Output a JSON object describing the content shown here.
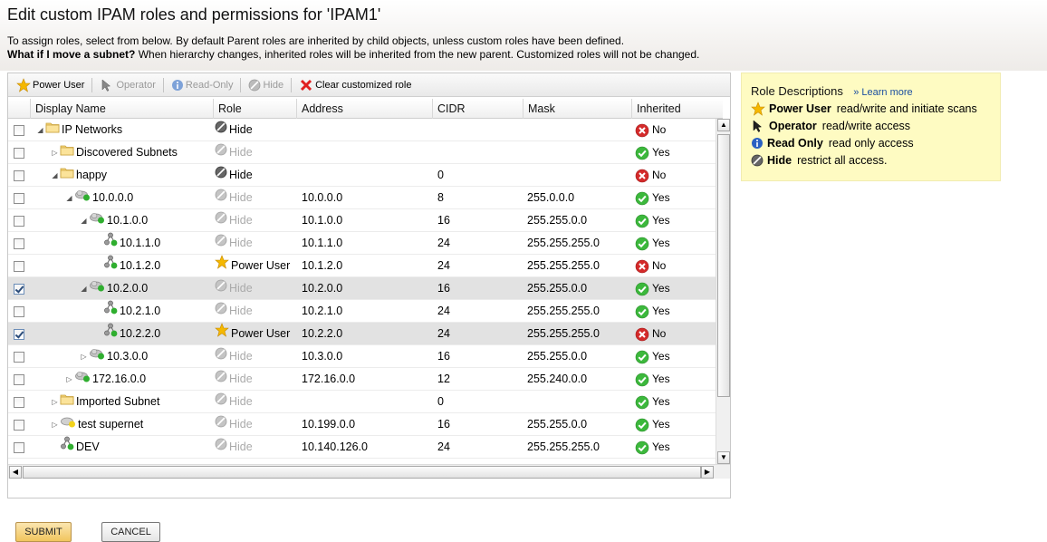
{
  "page": {
    "title": "Edit custom IPAM roles and permissions for 'IPAM1'",
    "intro_line1": "To assign roles, select from below. By default Parent roles are inherited by child objects, unless custom roles have been defined.",
    "intro_q": "What if I move a subnet?",
    "intro_line2": " When hierarchy changes, inherited roles will be inherited from the new parent. Customized roles will not be changed."
  },
  "toolbar": {
    "power_user": "Power User",
    "operator": "Operator",
    "read_only": "Read-Only",
    "hide": "Hide",
    "clear": "Clear customized role"
  },
  "columns": {
    "display_name": "Display Name",
    "role": "Role",
    "address": "Address",
    "cidr": "CIDR",
    "mask": "Mask",
    "inherited": "Inherited"
  },
  "rows": [
    {
      "indent": 0,
      "toggle": "open",
      "icon": "folder",
      "name": "IP Networks",
      "role": "Hide",
      "role_type": "hide-active",
      "address": "",
      "cidr": "",
      "mask": "",
      "inherited": "No",
      "checked": false,
      "selected": false
    },
    {
      "indent": 1,
      "toggle": "closed",
      "icon": "folder",
      "name": "Discovered Subnets",
      "role": "Hide",
      "role_type": "hide",
      "address": "",
      "cidr": "",
      "mask": "",
      "inherited": "Yes",
      "checked": false,
      "selected": false
    },
    {
      "indent": 1,
      "toggle": "open",
      "icon": "folder",
      "name": "happy",
      "role": "Hide",
      "role_type": "hide-active",
      "address": "",
      "cidr": "0",
      "mask": "",
      "inherited": "No",
      "checked": false,
      "selected": false
    },
    {
      "indent": 2,
      "toggle": "open",
      "icon": "cloud",
      "name": "10.0.0.0",
      "role": "Hide",
      "role_type": "hide",
      "address": "10.0.0.0",
      "cidr": "8",
      "mask": "255.0.0.0",
      "inherited": "Yes",
      "checked": false,
      "selected": false
    },
    {
      "indent": 3,
      "toggle": "open",
      "icon": "cloud",
      "name": "10.1.0.0",
      "role": "Hide",
      "role_type": "hide",
      "address": "10.1.0.0",
      "cidr": "16",
      "mask": "255.255.0.0",
      "inherited": "Yes",
      "checked": false,
      "selected": false
    },
    {
      "indent": 4,
      "toggle": "",
      "icon": "subnet",
      "name": "10.1.1.0",
      "role": "Hide",
      "role_type": "hide",
      "address": "10.1.1.0",
      "cidr": "24",
      "mask": "255.255.255.0",
      "inherited": "Yes",
      "checked": false,
      "selected": false
    },
    {
      "indent": 4,
      "toggle": "",
      "icon": "subnet",
      "name": "10.1.2.0",
      "role": "Power User",
      "role_type": "power",
      "address": "10.1.2.0",
      "cidr": "24",
      "mask": "255.255.255.0",
      "inherited": "No",
      "checked": false,
      "selected": false
    },
    {
      "indent": 3,
      "toggle": "open",
      "icon": "cloud",
      "name": "10.2.0.0",
      "role": "Hide",
      "role_type": "hide",
      "address": "10.2.0.0",
      "cidr": "16",
      "mask": "255.255.0.0",
      "inherited": "Yes",
      "checked": true,
      "selected": true
    },
    {
      "indent": 4,
      "toggle": "",
      "icon": "subnet",
      "name": "10.2.1.0",
      "role": "Hide",
      "role_type": "hide",
      "address": "10.2.1.0",
      "cidr": "24",
      "mask": "255.255.255.0",
      "inherited": "Yes",
      "checked": false,
      "selected": false
    },
    {
      "indent": 4,
      "toggle": "",
      "icon": "subnet",
      "name": "10.2.2.0",
      "role": "Power User",
      "role_type": "power",
      "address": "10.2.2.0",
      "cidr": "24",
      "mask": "255.255.255.0",
      "inherited": "No",
      "checked": true,
      "selected": true
    },
    {
      "indent": 3,
      "toggle": "closed",
      "icon": "cloud",
      "name": "10.3.0.0",
      "role": "Hide",
      "role_type": "hide",
      "address": "10.3.0.0",
      "cidr": "16",
      "mask": "255.255.0.0",
      "inherited": "Yes",
      "checked": false,
      "selected": false
    },
    {
      "indent": 2,
      "toggle": "closed",
      "icon": "cloud",
      "name": "172.16.0.0",
      "role": "Hide",
      "role_type": "hide",
      "address": "172.16.0.0",
      "cidr": "12",
      "mask": "255.240.0.0",
      "inherited": "Yes",
      "checked": false,
      "selected": false
    },
    {
      "indent": 1,
      "toggle": "closed",
      "icon": "folder",
      "name": "Imported Subnet",
      "role": "Hide",
      "role_type": "hide",
      "address": "",
      "cidr": "0",
      "mask": "",
      "inherited": "Yes",
      "checked": false,
      "selected": false
    },
    {
      "indent": 1,
      "toggle": "closed",
      "icon": "supernet",
      "name": "test supernet",
      "role": "Hide",
      "role_type": "hide",
      "address": "10.199.0.0",
      "cidr": "16",
      "mask": "255.255.0.0",
      "inherited": "Yes",
      "checked": false,
      "selected": false
    },
    {
      "indent": 1,
      "toggle": "",
      "icon": "subnet",
      "name": "DEV",
      "role": "Hide",
      "role_type": "hide",
      "address": "10.140.126.0",
      "cidr": "24",
      "mask": "255.255.255.0",
      "inherited": "Yes",
      "checked": false,
      "selected": false
    }
  ],
  "role_descriptions": {
    "title": "Role Descriptions",
    "learn_more": "» Learn more",
    "items": [
      {
        "icon": "star-icon",
        "name": "Power User",
        "desc": "read/write and initiate scans"
      },
      {
        "icon": "cursor-icon",
        "name": "Operator",
        "desc": "read/write access"
      },
      {
        "icon": "info-icon",
        "name": "Read Only",
        "desc": "read only access"
      },
      {
        "icon": "hide-icon",
        "name": "Hide",
        "desc": "restrict all access."
      }
    ]
  },
  "buttons": {
    "submit": "SUBMIT",
    "cancel": "CANCEL"
  },
  "colors": {
    "accent_yellow_panel": "#fefbc2",
    "status_yes": "#3cb83c",
    "status_no": "#d42a2a",
    "selected_row": "#e2e2e2"
  }
}
